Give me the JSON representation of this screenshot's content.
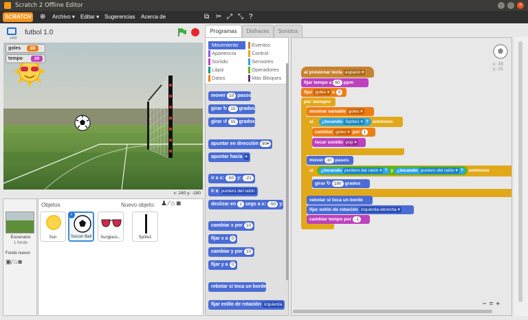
{
  "window": {
    "title": "Scratch 2 Offline Editor"
  },
  "menu": {
    "logo": "SCRATCH",
    "archivo": "Archivo ▾",
    "editar": "Editar ▾",
    "sugerencias": "Sugerencias",
    "acerca": "Acerca de"
  },
  "stage": {
    "project_name": "futbol 1.0",
    "version": "v442",
    "coords": "x: 240  y: -180",
    "monitors": [
      {
        "label": "goles",
        "value": "88"
      },
      {
        "label": "tempo",
        "value": "20"
      }
    ]
  },
  "sprites": {
    "header": "Objetos",
    "new_label": "Nuevo objeto:",
    "items": [
      "Sun",
      "Soccer Ball",
      "Sunglass...",
      "Sprite1"
    ],
    "stage_label": "Escenario",
    "stage_sub": "1 fondo",
    "new_backdrop": "Fondo nuevo:"
  },
  "tabs": [
    "Programas",
    "Disfraces",
    "Sonidos"
  ],
  "categories": {
    "left": [
      "Movimiento",
      "Apariencia",
      "Sonido",
      "Lápiz",
      "Datos"
    ],
    "right": [
      "Eventos",
      "Control",
      "Sensores",
      "Operadores",
      "Más Bloques"
    ]
  },
  "palette": {
    "move": "mover",
    "move_v": "10",
    "move_u": "pasos",
    "turn_r": "girar ↻",
    "turn_v": "15",
    "deg": "grados",
    "turn_l": "girar ↺",
    "point_dir": "apuntar en dirección",
    "point_dir_v": "90▾",
    "point_to": "apuntar hacia",
    "goto_xy": "ir a x:",
    "x_v": "-50",
    "y_l": "y:",
    "y_v": "-21",
    "goto": "ir a",
    "goto_v": "puntero del ratón",
    "glide": "deslizar en",
    "glide_v": "1",
    "glide_u": "segs a x:",
    "glide_x": "-50",
    "glide_y": "y:",
    "change_x": "cambiar x por",
    "change_x_v": "10",
    "set_x": "fijar x a",
    "set_x_v": "0",
    "change_y": "cambiar y por",
    "change_y_v": "10",
    "set_y": "fijar y a",
    "set_y_v": "0",
    "bounce": "rebotar si toca un borde",
    "rot": "fijar estilo de rotación",
    "rot_v": "izquierda"
  },
  "script": {
    "hat": "al presionar tecla",
    "hat_v": "espacio ▾",
    "tempo": "fijar tempo a",
    "tempo_v": "60",
    "tempo_u": "ppm",
    "set_goles": "fijar",
    "goles_v": "goles ▾",
    "a": "a",
    "zero": "0",
    "forever": "por siempre",
    "show_var": "mostrar variable",
    "show_var_v": "goles ▾",
    "if": "si",
    "touching": "¿tocando",
    "sprite1": "Sprite1 ▾",
    "q": "?",
    "then": "entonces",
    "change_by": "cambiar",
    "por": "por",
    "one": "1",
    "play": "tocar sonido",
    "pop": "pop ▾",
    "move": "mover",
    "move_v": "10",
    "pasos": "pasos",
    "mouse": "puntero del ratón ▾",
    "y": "y",
    "turn": "girar ↻",
    "turn_v": "180",
    "grados": "grados",
    "bounce": "rebotar si toca un borde",
    "rotstyle": "fijar estilo de rotación",
    "rotstyle_v": "izquierda-derecha ▾",
    "change_tempo": "cambiar tempo por",
    "change_tempo_v": "-1",
    "sprite_x": "x: -50",
    "sprite_y": "y: -21",
    "zoom": "− = +"
  }
}
